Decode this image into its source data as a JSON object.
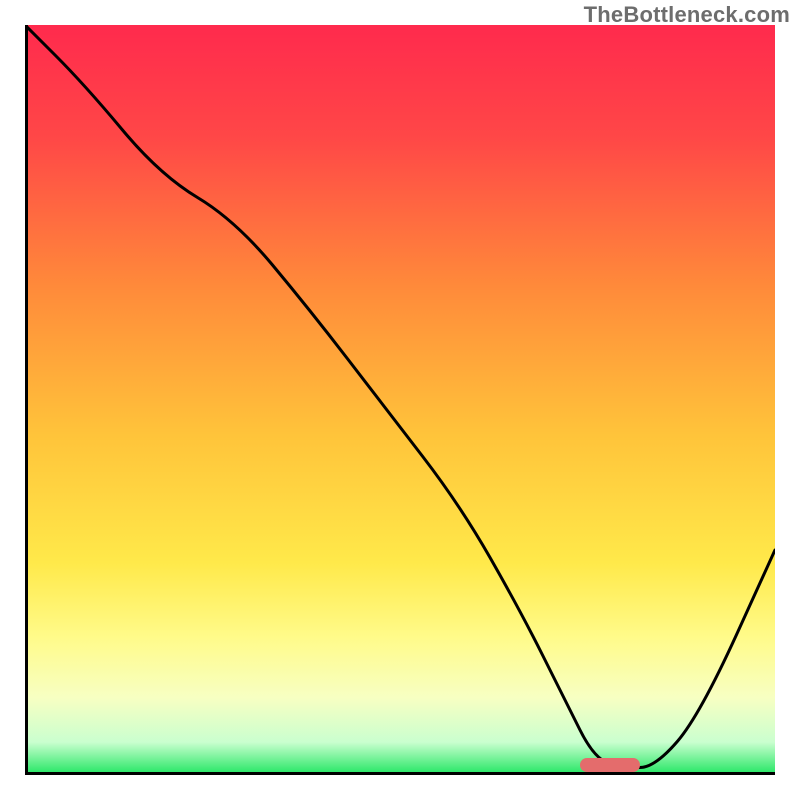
{
  "watermark": "TheBottleneck.com",
  "chart_data": {
    "type": "line",
    "title": "",
    "xlabel": "",
    "ylabel": "",
    "xlim": [
      0,
      100
    ],
    "ylim": [
      0,
      100
    ],
    "x": [
      0,
      8,
      18,
      28,
      38,
      48,
      58,
      66,
      72,
      76,
      80,
      84,
      90,
      100
    ],
    "values": [
      100,
      92,
      80,
      74,
      62,
      49,
      36,
      22,
      10,
      2,
      1,
      1,
      8,
      30
    ],
    "gradient_stops": [
      {
        "pct": 0,
        "color": "#ff2a4d"
      },
      {
        "pct": 15,
        "color": "#ff4747"
      },
      {
        "pct": 35,
        "color": "#ff8a3a"
      },
      {
        "pct": 55,
        "color": "#ffc43a"
      },
      {
        "pct": 72,
        "color": "#ffe94a"
      },
      {
        "pct": 82,
        "color": "#fffb8a"
      },
      {
        "pct": 90,
        "color": "#f7ffc2"
      },
      {
        "pct": 96,
        "color": "#caffcf"
      },
      {
        "pct": 100,
        "color": "#2fe86b"
      }
    ],
    "marker": {
      "x_pct": 78,
      "y_pct": 1,
      "color": "#e46c6c"
    }
  }
}
